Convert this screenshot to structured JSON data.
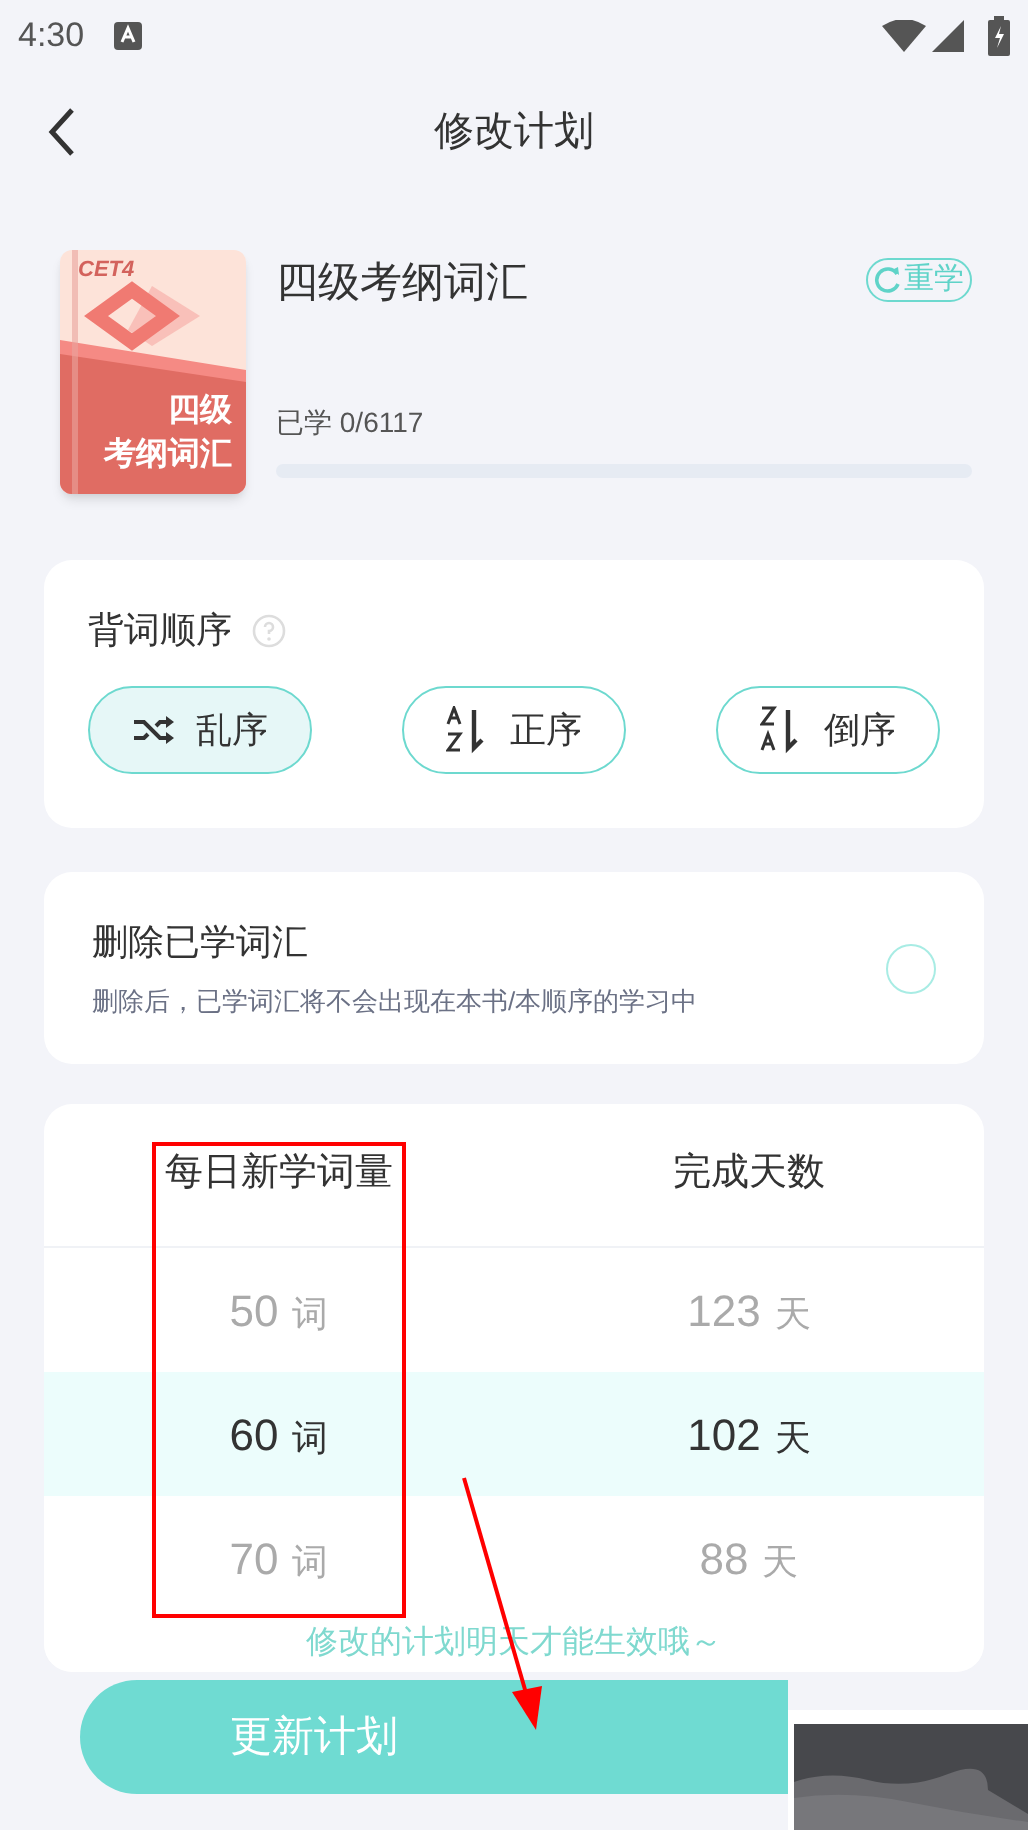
{
  "status_bar": {
    "time": "4:30"
  },
  "header": {
    "title": "修改计划"
  },
  "book": {
    "cover_tag": "CET4",
    "cover_title_lines": [
      "四级",
      "考纲词汇"
    ],
    "title": "四级考纲词汇",
    "restart_label": "重学",
    "progress_text": "已学 0/6117",
    "level": 0
  },
  "order": {
    "title": "背词顺序",
    "options": [
      {
        "kind": "shuffle",
        "label": "乱序",
        "selected": true
      },
      {
        "kind": "az",
        "label": "正序",
        "selected": false
      },
      {
        "kind": "za",
        "label": "倒序",
        "selected": false
      }
    ]
  },
  "delete_learned": {
    "title": "删除已学词汇",
    "description": "删除后，已学词汇将不会出现在本书/本顺序的学习中",
    "checked": false
  },
  "picker": {
    "columns": [
      "每日新学词量",
      "完成天数"
    ],
    "rows": [
      {
        "words": "50",
        "words_unit": "词",
        "days": "123",
        "days_unit": "天",
        "selected": false
      },
      {
        "words": "60",
        "words_unit": "词",
        "days": "102",
        "days_unit": "天",
        "selected": true
      },
      {
        "words": "70",
        "words_unit": "词",
        "days": "88",
        "days_unit": "天",
        "selected": false
      }
    ]
  },
  "note": "修改的计划明天才能生效哦～",
  "button": "更新计划"
}
